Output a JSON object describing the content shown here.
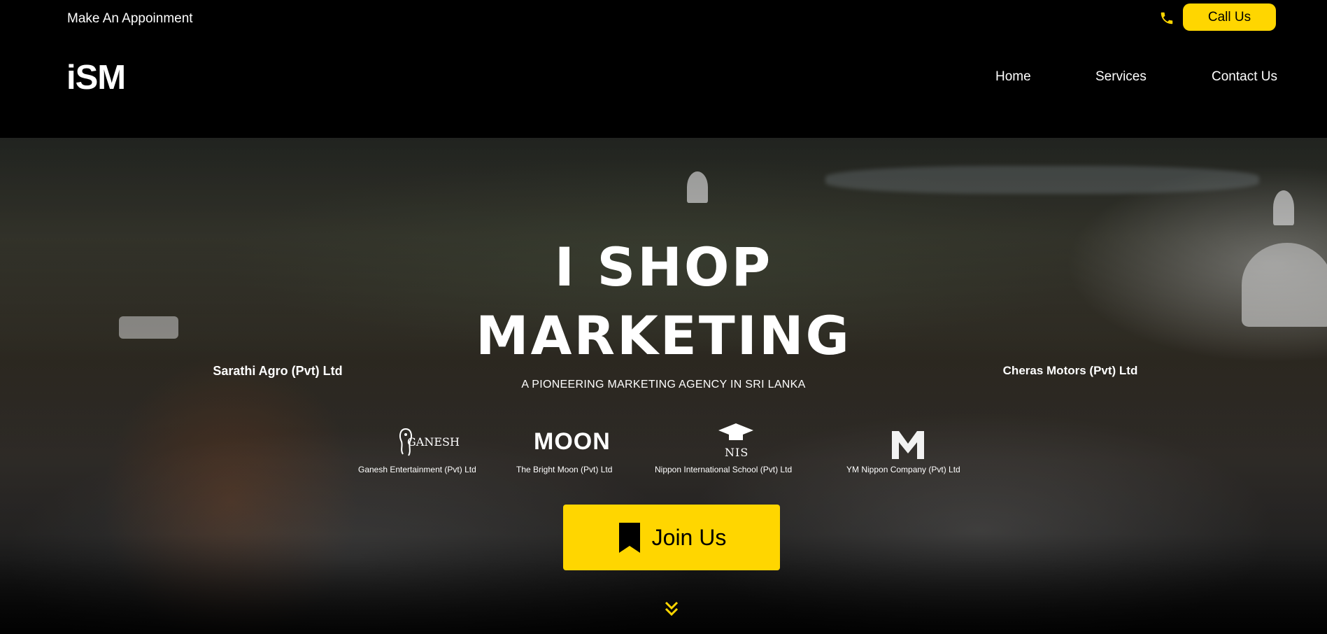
{
  "topbar": {
    "appointment_text": "Make An Appoinment",
    "call_label": "Call Us"
  },
  "nav": {
    "logo_text": "iSM",
    "links": [
      "Home",
      "Services",
      "Contact Us"
    ]
  },
  "hero": {
    "title_line1": "I SHOP",
    "title_line2": "MARKETING",
    "subtitle": "A PIONEERING MARKETING AGENCY IN SRI LANKA",
    "clients": [
      "Sarathi Agro (Pvt) Ltd",
      "Ganesh Entertainment (Pvt) Ltd",
      "The Bright Moon (Pvt) Ltd",
      "Nippon International School (Pvt) Ltd",
      "YM Nippon Company (Pvt) Ltd",
      "Cheras Motors (Pvt) Ltd"
    ],
    "logo_words": {
      "ganesh": "GANESH",
      "moon": "MOON",
      "nis": "NIS"
    },
    "join_label": "Join Us"
  },
  "colors": {
    "accent": "#ffd600",
    "background": "#000000",
    "text": "#ffffff"
  },
  "icons": {
    "phone": "phone-icon",
    "bookmark": "bookmark-icon",
    "scroll": "chevrons-down-icon"
  }
}
